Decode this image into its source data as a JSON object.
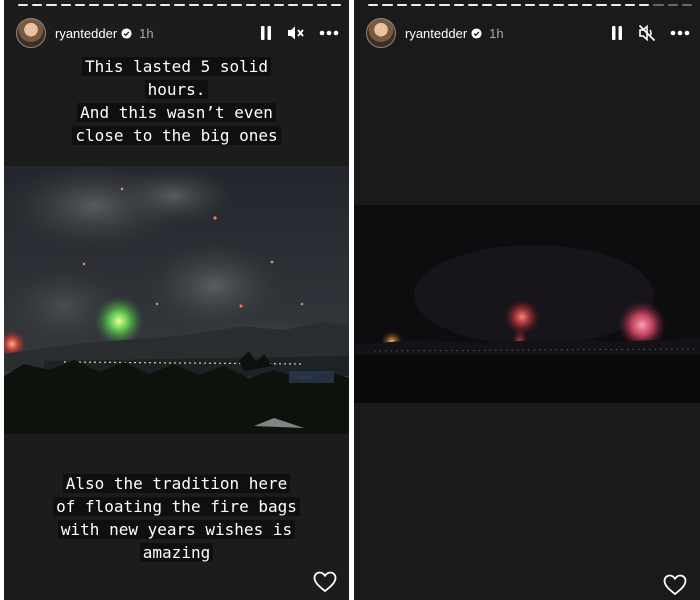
{
  "left_story": {
    "username": "ryantedder",
    "time": "1h",
    "caption_top": [
      "This lasted 5 solid",
      "hours.",
      "And this wasn’t even",
      "close to the big ones"
    ],
    "caption_bottom": [
      "Also the tradition here",
      "of floating the fire bags",
      "with new years wishes is",
      "amazing"
    ],
    "icons": {
      "pause": "pause-icon",
      "sound": "speaker-muted-icon",
      "more": "more-icon",
      "like": "heart-icon",
      "verified": "verified-badge-icon"
    },
    "progress_segments": 23
  },
  "right_story": {
    "username": "ryantedder",
    "time": "1h",
    "icons": {
      "pause": "pause-icon",
      "sound": "speaker-off-icon",
      "more": "more-icon",
      "like": "heart-icon",
      "verified": "verified-badge-icon"
    },
    "progress_segments": 23,
    "progress_completed": 20
  }
}
